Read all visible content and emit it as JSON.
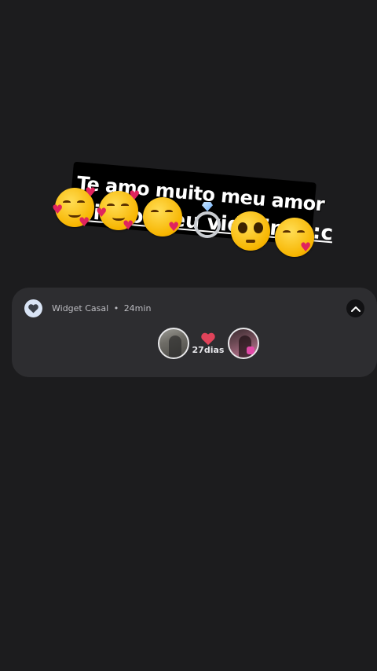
{
  "sticker": {
    "caption_line1": "Te amo muito meu amor",
    "caption_line2": "lindo meu vidolindo:c",
    "emojis": [
      "smiling-face-with-hearts",
      "smiling-face-with-hearts",
      "face-blowing-kiss",
      "ring",
      "pleading-face",
      "face-blowing-kiss"
    ]
  },
  "widget": {
    "app_name": "Widget Casal",
    "separator": "•",
    "time_ago": "24min",
    "days_count": "27dias",
    "accent_color": "#e0435a",
    "icon_bg_color": "#d9e4f5"
  }
}
